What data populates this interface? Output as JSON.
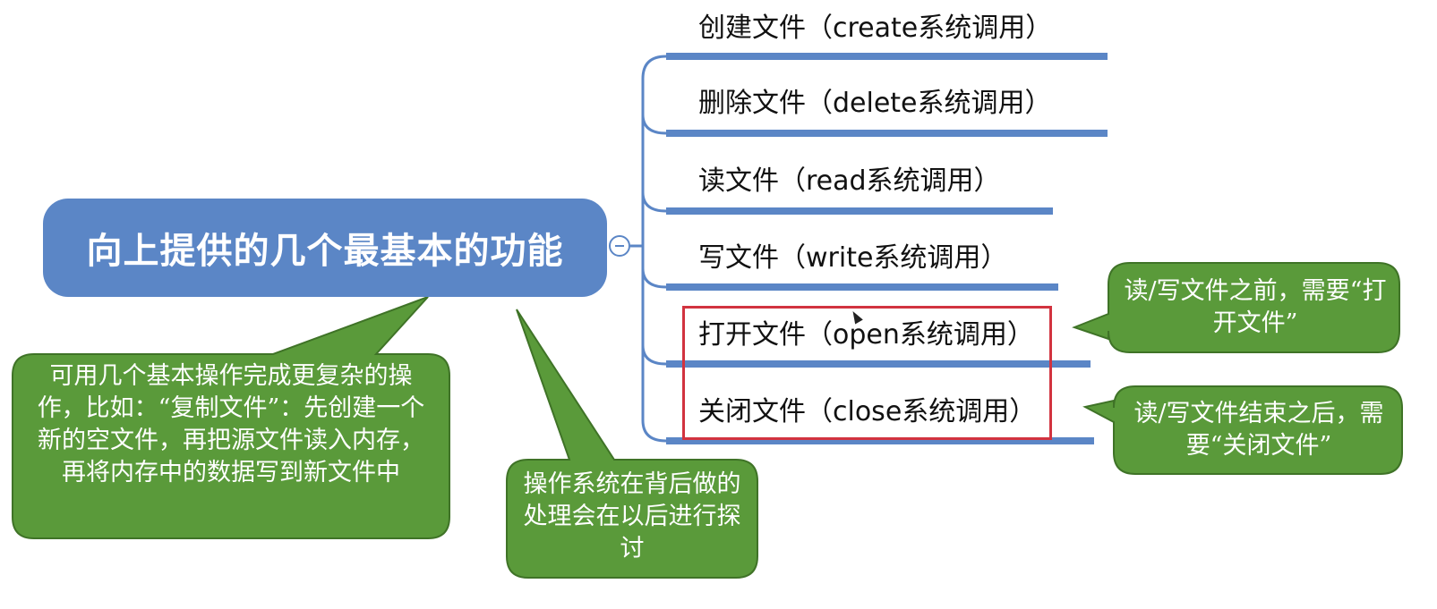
{
  "diagram": {
    "root": {
      "label": "向上提供的几个最基本的功能"
    },
    "branches": [
      {
        "id": "create",
        "label": "创建文件（create系统调用）"
      },
      {
        "id": "delete",
        "label": "删除文件（delete系统调用）"
      },
      {
        "id": "read",
        "label": "读文件（read系统调用）"
      },
      {
        "id": "write",
        "label": "写文件（write系统调用）"
      },
      {
        "id": "open",
        "label": "打开文件（open系统调用）"
      },
      {
        "id": "close",
        "label": "关闭文件（close系统调用）"
      }
    ],
    "highlighted_branches": [
      "open",
      "close"
    ],
    "callouts": {
      "composite_ops": "可用几个基本操作完成更复杂的操作，比如：“复制文件”：先创建一个新的空文件，再把源文件读入内存，再将内存中的数据写到新文件中",
      "os_background": "操作系统在背后做的处理会在以后进行探讨",
      "before_rw": "读/写文件之前，需要“打开文件”",
      "after_rw": "读/写文件结束之后，需要“关闭文件”"
    },
    "colors": {
      "root_fill": "#5b86c6",
      "connector": "#5b86c6",
      "callout_fill": "#5a9a3a",
      "callout_border": "#3f7327",
      "highlight_border": "#d2333f"
    }
  }
}
